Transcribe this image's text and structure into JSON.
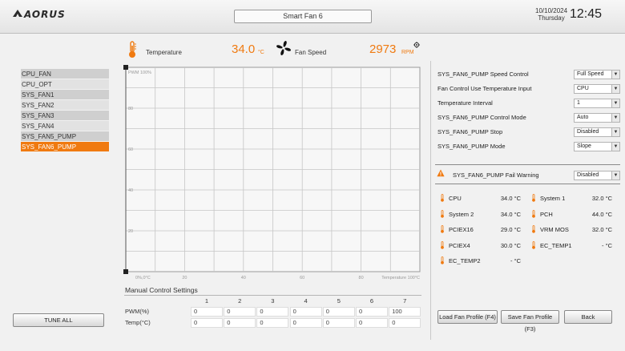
{
  "header": {
    "brand": "AORUS",
    "title": "Smart Fan 6",
    "date": "10/10/2024",
    "weekday": "Thursday",
    "time": "12:45"
  },
  "readout": {
    "temp_label": "Temperature",
    "temp_value": "34.0",
    "temp_unit": "°C",
    "fan_label": "Fan Speed",
    "fan_value": "2973",
    "fan_unit": "RPM"
  },
  "fan_list": [
    "CPU_FAN",
    "CPU_OPT",
    "SYS_FAN1",
    "SYS_FAN2",
    "SYS_FAN3",
    "SYS_FAN4",
    "SYS_FAN5_PUMP",
    "SYS_FAN6_PUMP"
  ],
  "selected_fan_index": 7,
  "buttons": {
    "tune_all": "TUNE ALL",
    "load_profile": "Load Fan Profile (F4)",
    "save_profile": "Save Fan Profile (F3)",
    "back": "Back"
  },
  "chart_data": {
    "type": "line",
    "y_axis_label": "PWM 100%",
    "x_axis_label": "Temperature 100°C",
    "origin_label": "0%,0°C",
    "x_ticks": [
      20,
      40,
      60,
      80
    ],
    "y_ticks": [
      80,
      60,
      40,
      20
    ],
    "xlim": [
      0,
      100
    ],
    "ylim": [
      0,
      100
    ],
    "grid": true,
    "points": [
      {
        "x": 0,
        "y": 100
      },
      {
        "x": 0,
        "y": 0
      }
    ]
  },
  "manual": {
    "title": "Manual Control Settings",
    "columns": [
      "1",
      "2",
      "3",
      "4",
      "5",
      "6",
      "7"
    ],
    "pwm_label": "PWM(%)",
    "temp_label": "Temp(°C)",
    "pwm_values": [
      "0",
      "0",
      "0",
      "0",
      "0",
      "0",
      "100"
    ],
    "temp_values": [
      "0",
      "0",
      "0",
      "0",
      "0",
      "0",
      "0"
    ]
  },
  "settings": [
    {
      "label": "SYS_FAN6_PUMP Speed Control",
      "value": "Full Speed"
    },
    {
      "label": "Fan Control Use Temperature Input",
      "value": "CPU"
    },
    {
      "label": "Temperature Interval",
      "value": "1"
    },
    {
      "label": "SYS_FAN6_PUMP Control Mode",
      "value": "Auto"
    },
    {
      "label": "SYS_FAN6_PUMP Stop",
      "value": "Disabled"
    },
    {
      "label": "SYS_FAN6_PUMP Mode",
      "value": "Slope"
    }
  ],
  "fail_warning": {
    "label": "SYS_FAN6_PUMP Fail Warning",
    "value": "Disabled"
  },
  "sensors": [
    {
      "name": "CPU",
      "value": "34.0 °C"
    },
    {
      "name": "System 1",
      "value": "32.0 °C"
    },
    {
      "name": "System 2",
      "value": "34.0 °C"
    },
    {
      "name": "PCH",
      "value": "44.0 °C"
    },
    {
      "name": "PCIEX16",
      "value": "29.0 °C"
    },
    {
      "name": "VRM MOS",
      "value": "32.0 °C"
    },
    {
      "name": "PCIEX4",
      "value": "30.0 °C"
    },
    {
      "name": "EC_TEMP1",
      "value": "- °C"
    },
    {
      "name": "EC_TEMP2",
      "value": "- °C"
    }
  ],
  "colors": {
    "accent": "#f07a10",
    "panel": "#f1f1f1"
  },
  "icons": [
    "thermometer-icon",
    "fan-icon",
    "gear-icon",
    "warning-icon"
  ]
}
